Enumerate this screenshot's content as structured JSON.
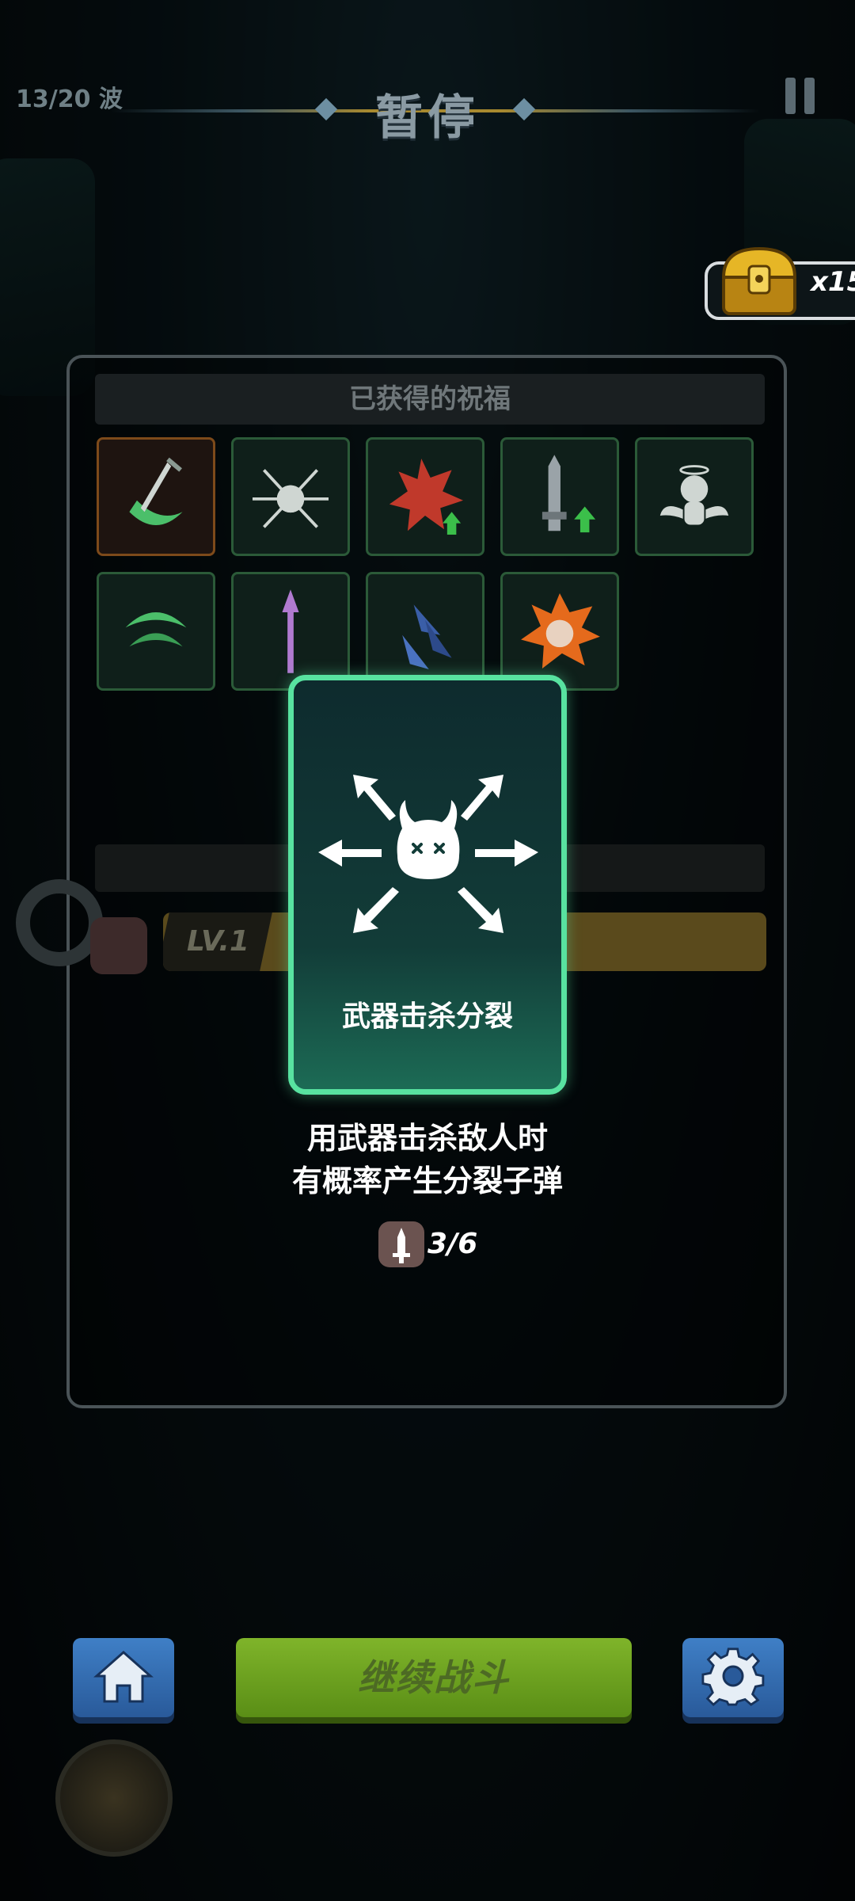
{
  "top": {
    "wave": "13/20 波",
    "title": "暂停"
  },
  "chest": {
    "count": "x15"
  },
  "panel": {
    "header": "已获得的祝福",
    "level_label": "LV.1"
  },
  "card": {
    "name": "武器击杀分裂",
    "desc_line1": "用武器击杀敌人时",
    "desc_line2": "有概率产生分裂子弹",
    "count": "3/6"
  },
  "buttons": {
    "continue": "继续战斗"
  },
  "colors": {
    "card_border": "#58e2a0",
    "continue": "#7fb42a",
    "side_buttons": "#3f7fc6"
  }
}
